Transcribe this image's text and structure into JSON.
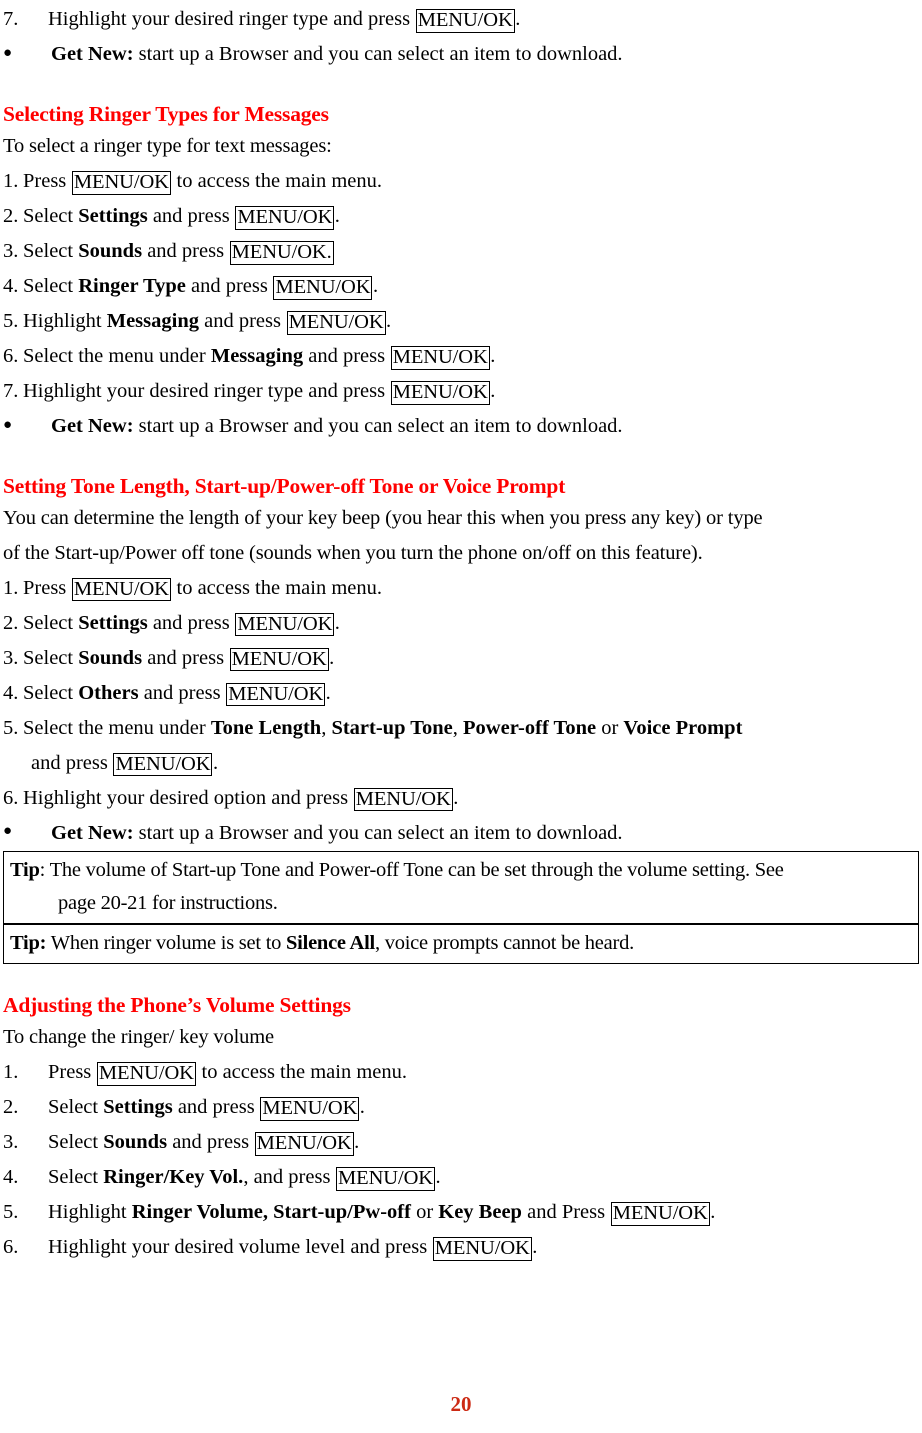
{
  "document": {
    "page_number": "20",
    "accent_color": "#ff0000",
    "key_label": "MENU/OK",
    "bullet_glyph": "●"
  },
  "top_section": {
    "step": {
      "marker": "7.",
      "before": "Highlight your desired ringer type and press ",
      "key": "MENU/OK",
      "after": "."
    },
    "get_new": {
      "bold": "Get New:",
      "text": " start up a Browser and you can select an item to download."
    }
  },
  "section_messages": {
    "heading": "Selecting Ringer Types for Messages",
    "intro": "To select a ringer type for text messages:",
    "steps": [
      {
        "marker": "1.",
        "before": "Press ",
        "key": "MENU/OK",
        "after": " to access the main menu."
      },
      {
        "marker": "2.",
        "before": "Select ",
        "bold": "Settings",
        "mid": " and press ",
        "key": "MENU/OK",
        "after": "."
      },
      {
        "marker": "3.",
        "before": "Select ",
        "bold": "Sounds",
        "mid": " and press ",
        "key": "MENU/OK.",
        "after": ""
      },
      {
        "marker": "4.",
        "before": "Select ",
        "bold": "Ringer Type",
        "mid": " and press ",
        "key": "MENU/OK",
        "after": "."
      },
      {
        "marker": "5.",
        "before": "Highlight ",
        "bold": "Messaging",
        "mid": " and press ",
        "key": "MENU/OK",
        "after": "."
      },
      {
        "marker": "6.",
        "before": "Select the menu under ",
        "bold": "Messaging",
        "mid": " and press ",
        "key": "MENU/OK",
        "after": "."
      },
      {
        "marker": "7.",
        "before": "Highlight your desired ringer type and press ",
        "key": "MENU/OK",
        "after": "."
      }
    ],
    "get_new": {
      "bold": "Get New:",
      "text": " start up a Browser and you can select an item to download."
    }
  },
  "section_tone": {
    "heading": "Setting Tone Length, Start-up/Power-off Tone or Voice Prompt",
    "intro_line1": "You can determine the length of your key beep (you hear this when you press any key) or type",
    "intro_line2": "of the Start-up/Power off tone (sounds when you turn the phone on/off on this feature).",
    "steps": [
      {
        "marker": "1.",
        "before": "Press ",
        "key": "MENU/OK",
        "after": " to access the main menu."
      },
      {
        "marker": "2.",
        "before": "Select ",
        "bold": "Settings",
        "mid": " and press ",
        "key": "MENU/OK",
        "after": "."
      },
      {
        "marker": "3.",
        "before": "Select ",
        "bold": "Sounds",
        "mid": " and press ",
        "key": "MENU/OK",
        "after": "."
      },
      {
        "marker": "4.",
        "before": "Select ",
        "bold": "Others",
        "mid": " and press ",
        "key": "MENU/OK",
        "after": "."
      }
    ],
    "step5": {
      "marker": "5.",
      "before": "Select the menu under ",
      "bold1": "Tone Length",
      "sep1": ", ",
      "bold2": "Start-up Tone",
      "sep2": ", ",
      "bold3": "Power-off Tone",
      "sep3": " or ",
      "bold4": "Voice Prompt",
      "cont_before": "and press ",
      "cont_key": "MENU/OK",
      "cont_after": "."
    },
    "step6": {
      "marker": "6.",
      "before": "Highlight your desired option and press ",
      "key": "MENU/OK",
      "after": "."
    },
    "get_new": {
      "bold": "Get New:",
      "text": " start up a Browser and you can select an item to download."
    },
    "tips": [
      {
        "label": "Tip",
        "sep": ": ",
        "line1": "The volume of Start-up Tone and Power-off Tone can be set through the volume setting. See",
        "line2": "page 20-21 for instructions."
      },
      {
        "label": "Tip:",
        "sep": " ",
        "before": "When ringer volume is set to ",
        "bold": "Silence All",
        "after": ", voice prompts cannot be heard."
      }
    ]
  },
  "section_volume": {
    "heading": "Adjusting the Phone’s Volume Settings",
    "intro": "To change the ringer/ key volume",
    "steps": [
      {
        "marker": "1.",
        "before": "Press ",
        "key": "MENU/OK",
        "after": " to access the main menu."
      },
      {
        "marker": "2.",
        "before": "Select ",
        "bold": "Settings",
        "mid": " and press ",
        "key": "MENU/OK",
        "after": "."
      },
      {
        "marker": "3.",
        "before": "Select ",
        "bold": "Sounds",
        "mid": " and press ",
        "key": "MENU/OK",
        "after": "."
      },
      {
        "marker": "4.",
        "before": "Select ",
        "bold": "Ringer/Key Vol.",
        "mid": ", and press ",
        "key": "MENU/OK",
        "after": "."
      }
    ],
    "step5": {
      "marker": "5.",
      "before": "Highlight ",
      "bold1": "Ringer Volume, Start-up/Pw-off",
      "sep1": " or ",
      "bold2": "Key Beep",
      "mid": " and Press ",
      "key": "MENU/OK",
      "after": "."
    },
    "step6": {
      "marker": "6.",
      "before": "Highlight your desired volume level and press ",
      "key": "MENU/OK",
      "after": "."
    }
  }
}
